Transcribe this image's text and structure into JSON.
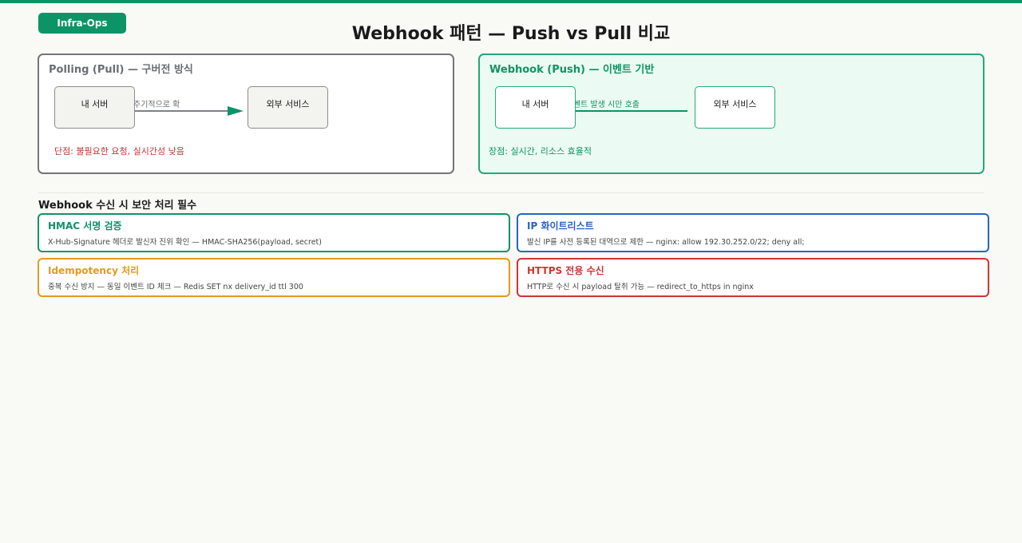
{
  "badge": "Infra-Ops",
  "title": "Webhook 패턴 — Push vs Pull 비교",
  "pull": {
    "title": "Polling (Pull) — 구버전 방식",
    "node_left": "내 서버",
    "node_right": "외부 서비스",
    "edge_label": "주기적으로 확인",
    "note": "단점: 불필요한 요청, 실시간성 낮음"
  },
  "push": {
    "title": "Webhook (Push) — 이벤트 기반",
    "node_left": "내 서버",
    "node_right": "외부 서비스",
    "edge_label": "이벤트 발생 시만 호출",
    "note": "장점: 실시간, 리소스 효율적"
  },
  "security": {
    "title": "Webhook 수신 시 보안 처리 필수",
    "cards": [
      {
        "title": "HMAC 서명 검증",
        "desc": "X-Hub-Signature 헤더로 발신자 진위 확인 — HMAC-SHA256(payload, secret)",
        "color": "#0d9466"
      },
      {
        "title": "IP 화이트리스트",
        "desc": "발신 IP를 사전 등록된 대역으로 제한 — nginx: allow 192.30.252.0/22; deny all;",
        "color": "#2962c8"
      },
      {
        "title": "Idempotency 처리",
        "desc": "중복 수신 방지 — 동일 이벤트 ID 체크 — Redis SET nx delivery_id ttl 300",
        "color": "#e39a1c"
      },
      {
        "title": "HTTPS 전용 수신",
        "desc": "HTTP로 수신 시 payload 탈취 가능 — redirect_to_https in nginx",
        "color": "#d03333"
      }
    ]
  },
  "colors": {
    "accent": "#0d9466",
    "pull_border": "#73757a",
    "warning": "#c73333"
  }
}
